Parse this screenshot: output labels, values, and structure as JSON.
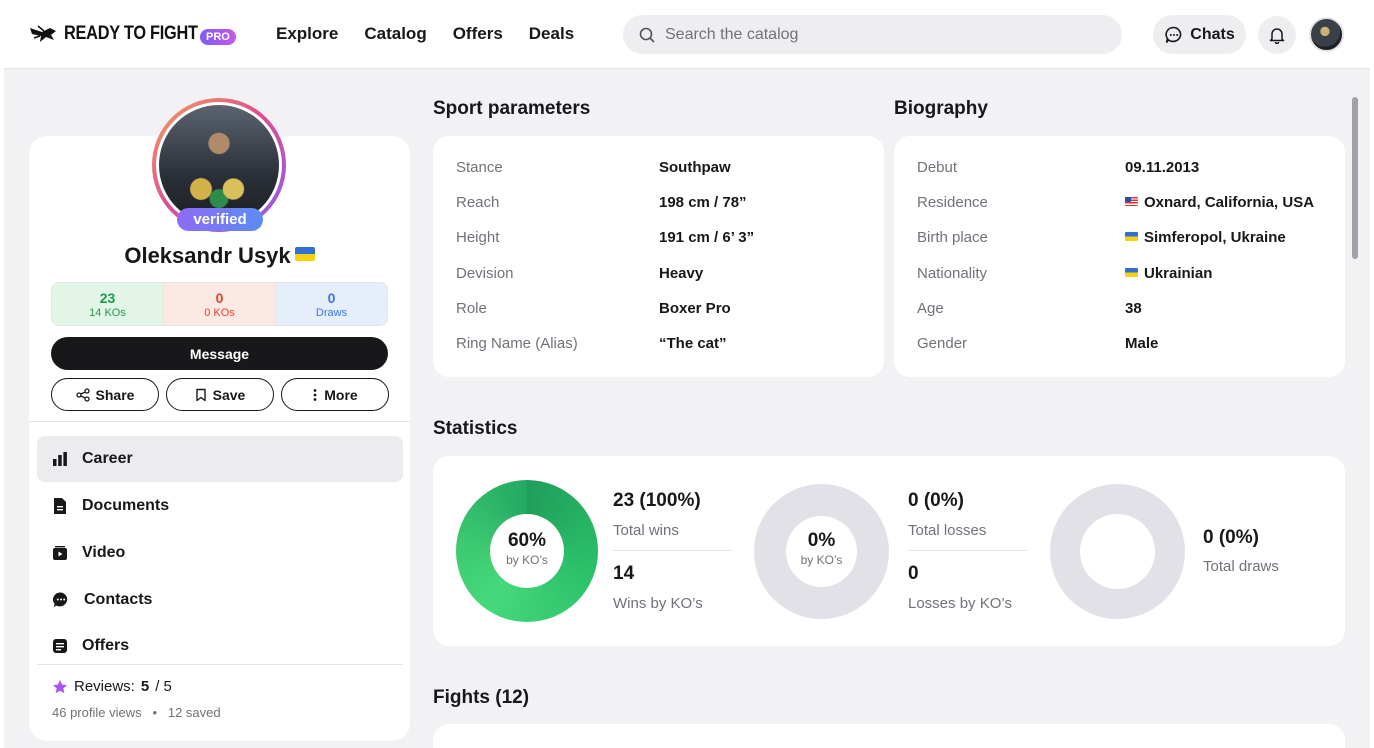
{
  "header": {
    "logo_text": "READY TO FIGHT",
    "logo_badge": "PRO",
    "nav": [
      "Explore",
      "Catalog",
      "Offers",
      "Deals"
    ],
    "search_placeholder": "Search the catalog",
    "chats_label": "Chats"
  },
  "profile": {
    "verified_label": "verified",
    "name": "Oleksandr Usyk",
    "tiles": [
      {
        "value": "23",
        "label": "14 KOs"
      },
      {
        "value": "0",
        "label": "0 KOs"
      },
      {
        "value": "0",
        "label": "Draws"
      }
    ],
    "message_label": "Message",
    "share_label": "Share",
    "save_label": "Save",
    "more_label": "More",
    "menu": [
      "Career",
      "Documents",
      "Video",
      "Contacts",
      "Offers"
    ],
    "reviews_label": "Reviews:",
    "reviews_score": "5",
    "reviews_total": "/ 5",
    "views": "46 profile views",
    "saved": "12 saved"
  },
  "sport": {
    "title": "Sport parameters",
    "rows": [
      {
        "k": "Stance",
        "v": "Southpaw"
      },
      {
        "k": "Reach",
        "v": "198 cm / 78”"
      },
      {
        "k": "Height",
        "v": "191 cm / 6’ 3”"
      },
      {
        "k": "Devision",
        "v": "Heavy"
      },
      {
        "k": "Role",
        "v": "Boxer Pro"
      },
      {
        "k": "Ring Name (Alias)",
        "v": "“The cat”"
      }
    ]
  },
  "bio": {
    "title": "Biography",
    "rows": [
      {
        "k": "Debut",
        "v": "09.11.2013"
      },
      {
        "k": "Residence",
        "v": "Oxnard, California, USA"
      },
      {
        "k": "Birth place",
        "v": "Simferopol, Ukraine"
      },
      {
        "k": "Nationality",
        "v": "Ukrainian"
      },
      {
        "k": "Age",
        "v": "38"
      },
      {
        "k": "Gender",
        "v": "Male"
      }
    ]
  },
  "statistics": {
    "title": "Statistics",
    "wins": {
      "ko_pct": "60%",
      "ko_label": "by KO’s",
      "total": "23 (100%)",
      "total_label": "Total wins",
      "ko": "14",
      "ko_caption": "Wins by KO’s",
      "ko_fraction": 0.6
    },
    "losses": {
      "ko_pct": "0%",
      "ko_label": "by KO’s",
      "total": "0 (0%)",
      "total_label": "Total losses",
      "ko": "0",
      "ko_caption": "Losses by KO’s"
    },
    "draws": {
      "total": "0 (0%)",
      "total_label": "Total draws"
    }
  },
  "fights": {
    "title": "Fights (12)"
  },
  "colors": {
    "win_green": "#22c55e",
    "loss_red": "#e0452c",
    "draw_blue": "#3d75e2",
    "accent_purple": "#8f6bf5"
  }
}
